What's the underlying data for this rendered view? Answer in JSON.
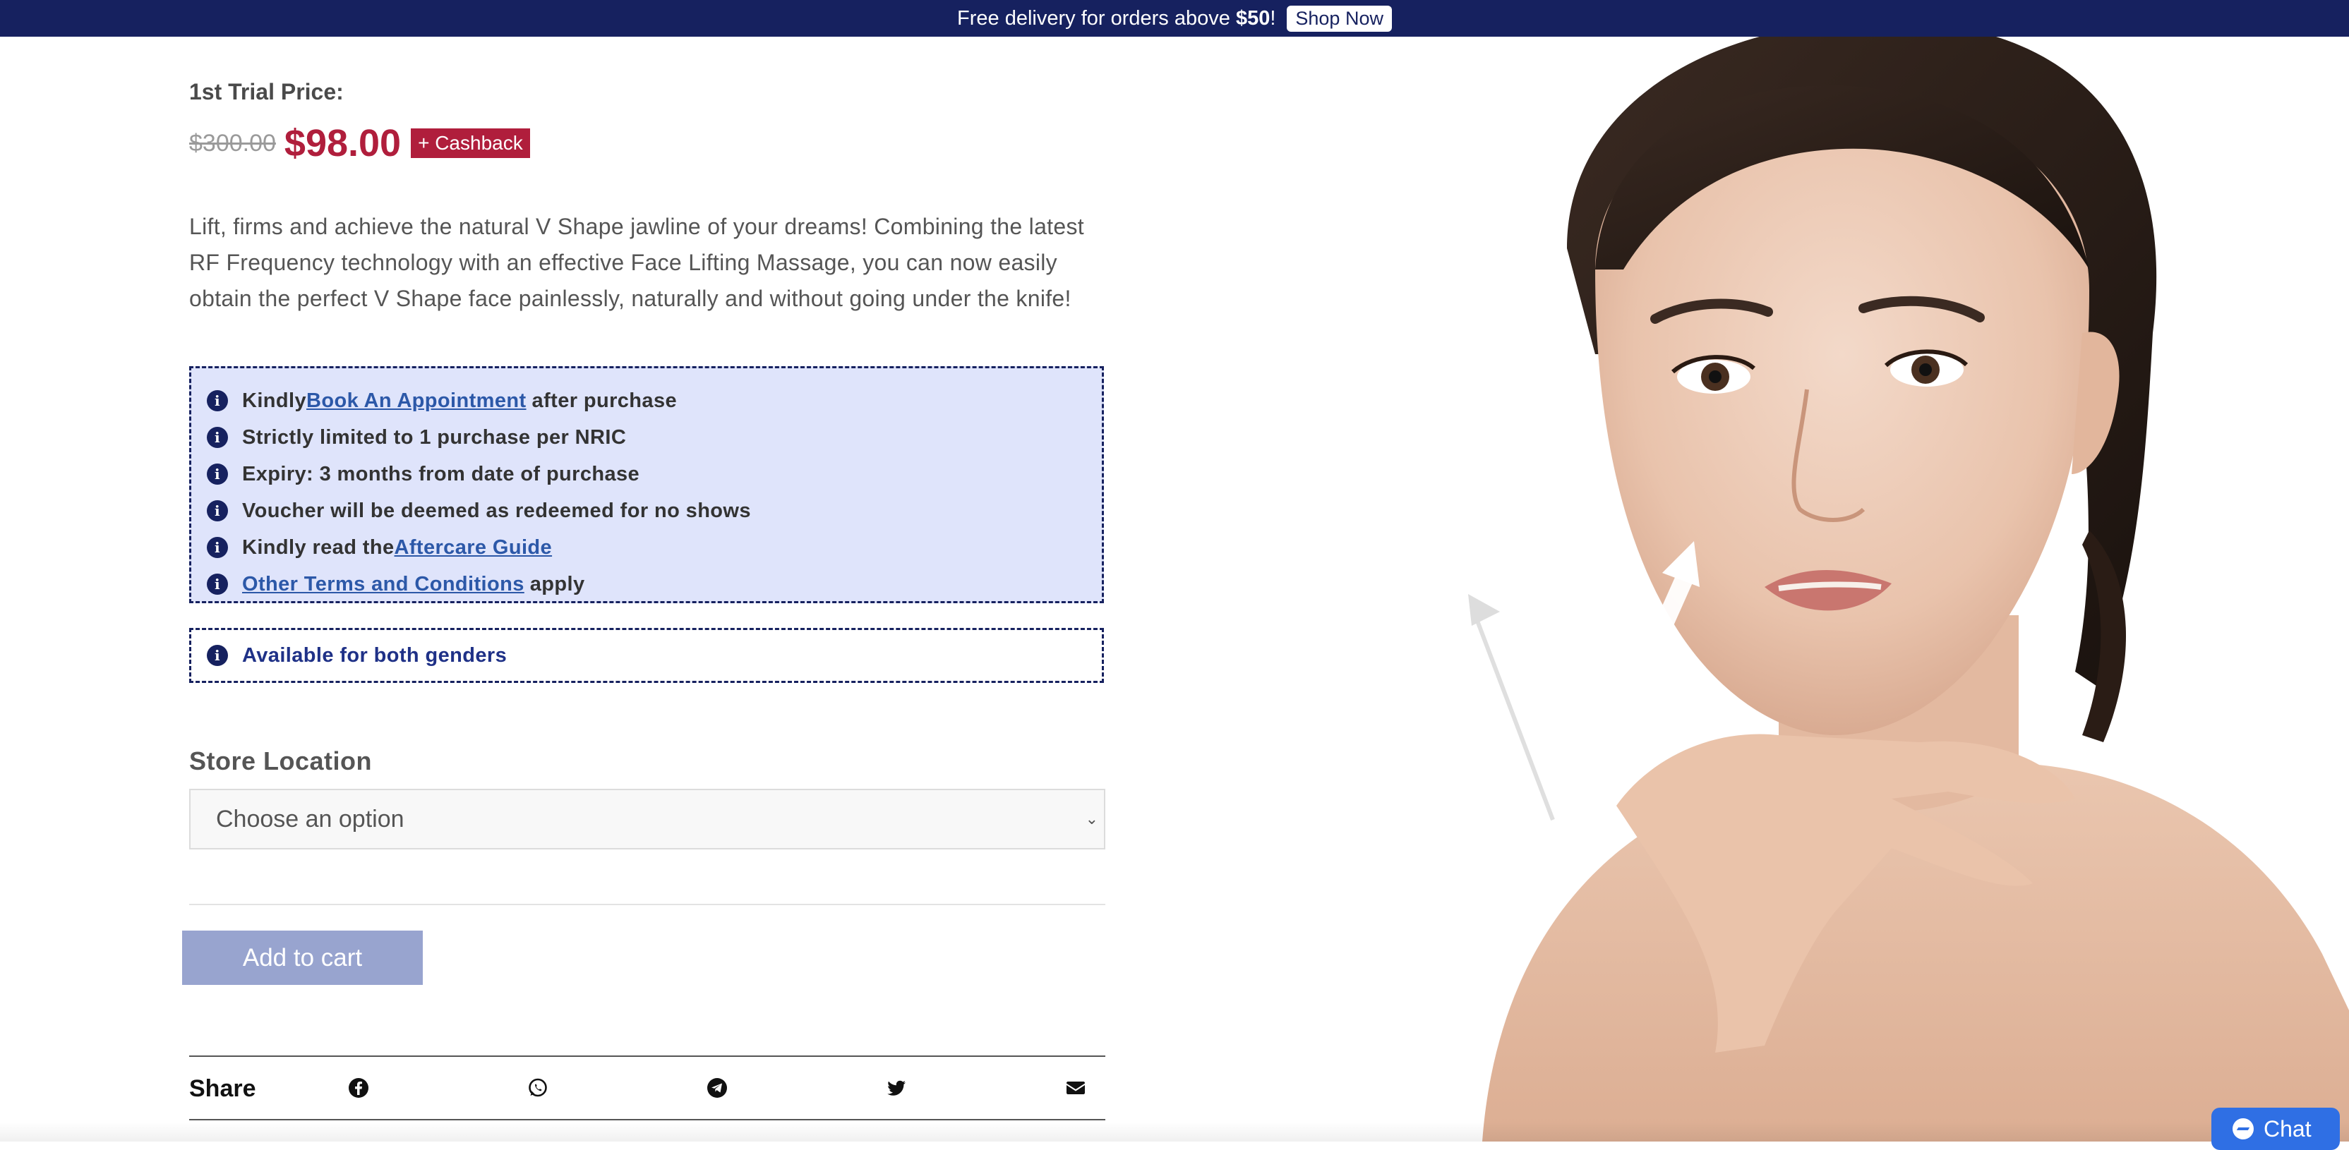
{
  "announcement": {
    "text_before": "Free delivery for orders above ",
    "amount": "$50",
    "text_after": "!",
    "button": "Shop Now"
  },
  "product": {
    "trial_label": "1st Trial Price:",
    "old_price": "$300.00",
    "new_price": "$98.00",
    "cashback_badge": "+ Cashback",
    "description": "Lift, firms and achieve the natural V Shape jawline of your dreams! Combining the latest RF Frequency technology with an effective Face Lifting Massage, you can now easily obtain the perfect V Shape face painlessly, naturally and without going under the knife!"
  },
  "info_list": [
    {
      "before": "Kindly ",
      "link": "Book An Appointment",
      "after": " after purchase"
    },
    {
      "text": "Strictly limited to 1 purchase per NRIC"
    },
    {
      "text": "Expiry: 3 months from date of purchase"
    },
    {
      "text": "Voucher will be deemed as redeemed for no shows"
    },
    {
      "before": "Kindly read the ",
      "link": "Aftercare Guide",
      "after": ""
    },
    {
      "before": "",
      "link": "Other Terms and Conditions",
      "after": " apply"
    }
  ],
  "gender_note": "Available for both genders",
  "store": {
    "label": "Store Location",
    "selected": "Choose an option"
  },
  "cart": {
    "add_label": "Add to cart"
  },
  "share": {
    "label": "Share",
    "icons": [
      "facebook-icon",
      "whatsapp-icon",
      "telegram-icon",
      "twitter-icon",
      "email-icon"
    ]
  },
  "chat": {
    "label": "Chat"
  },
  "colors": {
    "brand_navy": "#16215f",
    "price_red": "#b01e3c",
    "info_bg": "#dfe4fb",
    "cart_button": "#98a4cf",
    "chat_blue": "#2f6fe4"
  }
}
